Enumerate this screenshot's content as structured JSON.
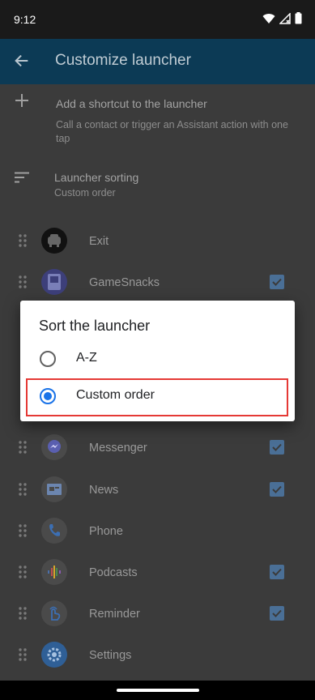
{
  "status_bar": {
    "time": "9:12",
    "icons": [
      "wifi-icon",
      "signal-icon",
      "battery-icon"
    ]
  },
  "app_bar": {
    "title": "Customize launcher",
    "back_icon": "arrow-back-icon"
  },
  "add_shortcut": {
    "title": "Add a shortcut to the launcher",
    "subtitle": "Call a contact or trigger an Assistant action with one tap"
  },
  "sorting": {
    "title": "Launcher sorting",
    "subtitle": "Custom order"
  },
  "apps": [
    {
      "label": "Exit",
      "icon": "car-icon",
      "checked": null
    },
    {
      "label": "GameSnacks",
      "icon": "game-icon",
      "checked": true
    },
    {
      "label": "Messenger",
      "icon": "messenger-icon",
      "checked": true
    },
    {
      "label": "News",
      "icon": "news-icon",
      "checked": true
    },
    {
      "label": "Phone",
      "icon": "phone-icon",
      "checked": null
    },
    {
      "label": "Podcasts",
      "icon": "podcasts-icon",
      "checked": true
    },
    {
      "label": "Reminder",
      "icon": "reminder-icon",
      "checked": true
    },
    {
      "label": "Settings",
      "icon": "settings-icon",
      "checked": null
    }
  ],
  "dialog": {
    "title": "Sort the launcher",
    "options": [
      {
        "label": "A-Z",
        "selected": false
      },
      {
        "label": "Custom order",
        "selected": true
      }
    ]
  },
  "colors": {
    "app_bar": "#0c3a55",
    "accent": "#1a73e8",
    "highlight": "#e53935"
  }
}
